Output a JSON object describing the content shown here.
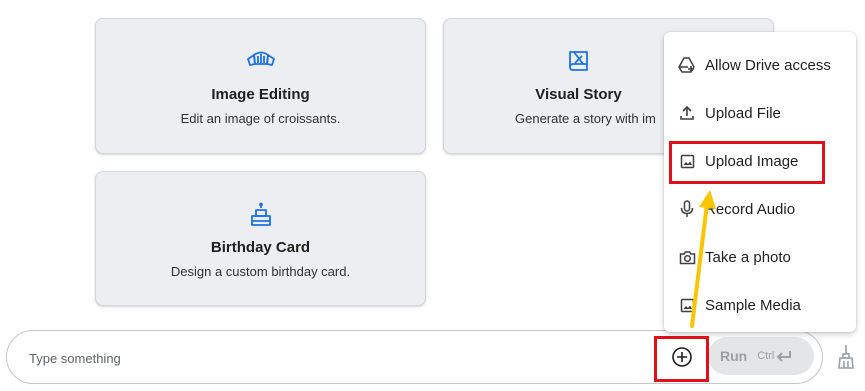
{
  "cards": [
    {
      "title": "Image Editing",
      "description": "Edit an image of croissants.",
      "icon": "croissant-icon"
    },
    {
      "title": "Visual Story",
      "description": "Generate a story with im",
      "icon": "story-book-icon"
    },
    {
      "title": "Birthday Card",
      "description": "Design a custom birthday card.",
      "icon": "cake-icon"
    }
  ],
  "menu": {
    "items": [
      {
        "label": "Allow Drive access",
        "icon": "drive-add-icon"
      },
      {
        "label": "Upload File",
        "icon": "upload-icon"
      },
      {
        "label": "Upload Image",
        "icon": "image-icon"
      },
      {
        "label": "Record Audio",
        "icon": "mic-icon"
      },
      {
        "label": "Take a photo",
        "icon": "camera-icon"
      },
      {
        "label": "Sample Media",
        "icon": "image-icon"
      }
    ]
  },
  "prompt": {
    "placeholder": "Type something",
    "run_label": "Run",
    "shortcut": "Ctrl"
  },
  "colors": {
    "accent_blue": "#1a73e8",
    "highlight_red": "#e0101a",
    "arrow_yellow": "#fbc500"
  }
}
